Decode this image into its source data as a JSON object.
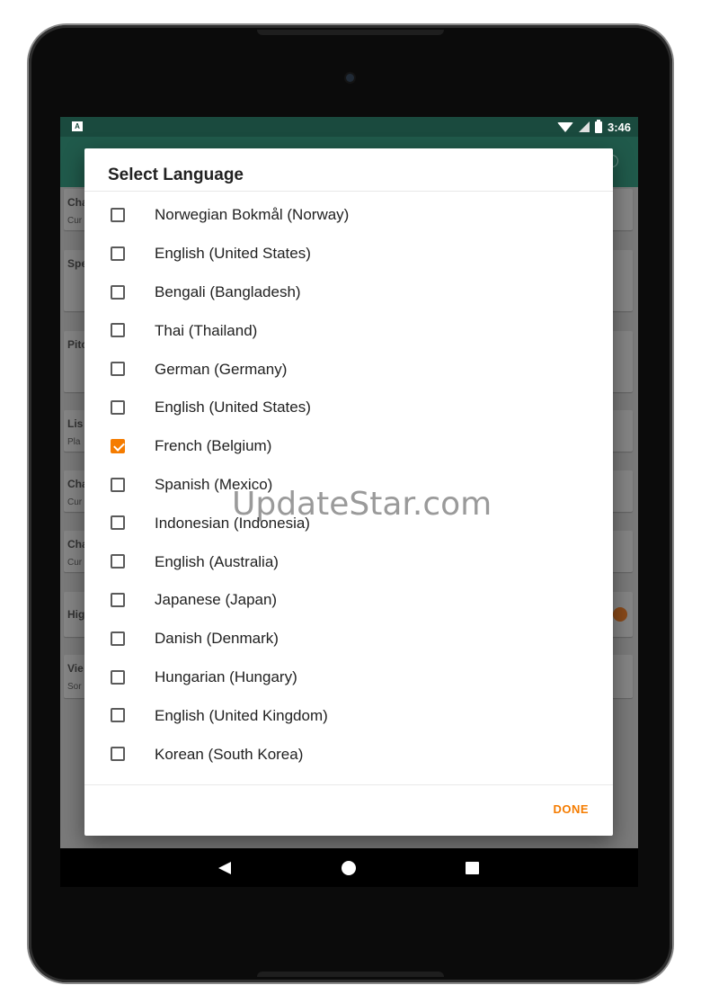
{
  "status_bar": {
    "notification_icon": "A",
    "time": "3:46",
    "icons": [
      "wifi-icon",
      "cell-signal-icon",
      "battery-icon"
    ]
  },
  "background_cards": [
    {
      "title": "Cha",
      "subtitle": "Cur"
    },
    {
      "title": "Spe",
      "subtitle": ""
    },
    {
      "title": "Pitc",
      "subtitle": ""
    },
    {
      "title": "Lis",
      "subtitle": "Pla"
    },
    {
      "title": "Cha",
      "subtitle": "Cur"
    },
    {
      "title": "Cha",
      "subtitle": "Cur"
    },
    {
      "title": "Hig",
      "subtitle": ""
    },
    {
      "title": "Vie",
      "subtitle": "Sor"
    }
  ],
  "dialog": {
    "title": "Select Language",
    "languages": [
      {
        "label": "Norwegian Bokmål (Norway)",
        "checked": false
      },
      {
        "label": "English (United States)",
        "checked": false
      },
      {
        "label": "Bengali (Bangladesh)",
        "checked": false
      },
      {
        "label": "Thai (Thailand)",
        "checked": false
      },
      {
        "label": "German (Germany)",
        "checked": false
      },
      {
        "label": "English (United States)",
        "checked": false
      },
      {
        "label": "French (Belgium)",
        "checked": true
      },
      {
        "label": "Spanish (Mexico)",
        "checked": false
      },
      {
        "label": "Indonesian (Indonesia)",
        "checked": false
      },
      {
        "label": "English (Australia)",
        "checked": false
      },
      {
        "label": "Japanese (Japan)",
        "checked": false
      },
      {
        "label": "Danish (Denmark)",
        "checked": false
      },
      {
        "label": "Hungarian (Hungary)",
        "checked": false
      },
      {
        "label": "English (United Kingdom)",
        "checked": false
      },
      {
        "label": "Korean (South Korea)",
        "checked": false
      }
    ],
    "done_label": "DONE"
  },
  "watermark": "UpdateStar.com",
  "colors": {
    "status_bar": "#1a4a3e",
    "app_bar": "#205a4b",
    "accent": "#f57c00"
  }
}
